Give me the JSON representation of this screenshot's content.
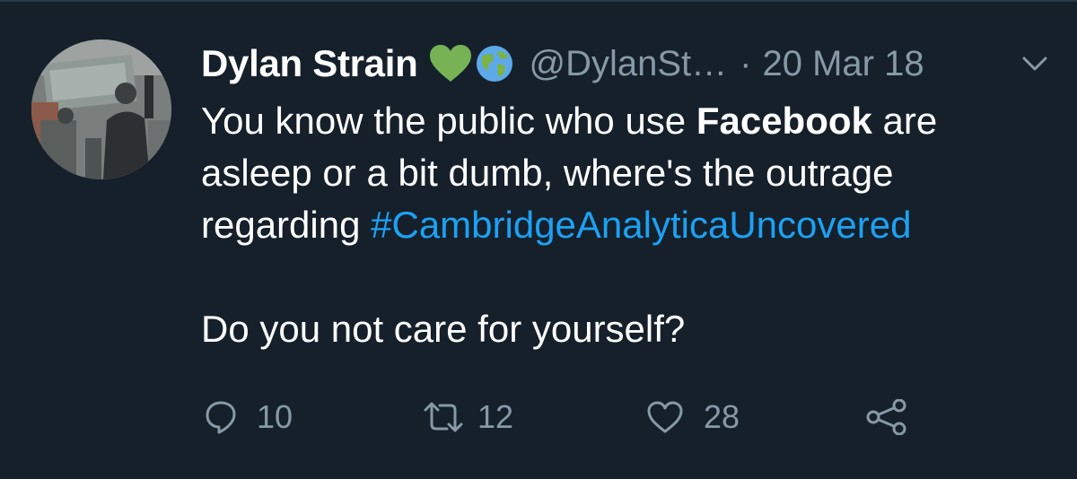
{
  "tweet": {
    "author_name": "Dylan Strain",
    "handle": "@DylanSt…",
    "separator": "·",
    "date": "20 Mar 18",
    "badges": [
      "green-heart-icon",
      "globe-icon"
    ],
    "text": {
      "line1_prefix": "You know the public who use ",
      "line1_bold": "Facebook",
      "line1_suffix": " are",
      "line2": "asleep or a bit dumb, where's the outrage",
      "line3_prefix": "regarding ",
      "hashtag": "#CambridgeAnalyticaUncovered",
      "line5": "Do you not care for yourself?"
    },
    "actions": {
      "reply_count": "10",
      "retweet_count": "12",
      "like_count": "28"
    }
  },
  "colors": {
    "background": "#15202b",
    "text": "#ffffff",
    "muted": "#8899a6",
    "link": "#1da1f2",
    "heart_badge": "#77b255"
  }
}
